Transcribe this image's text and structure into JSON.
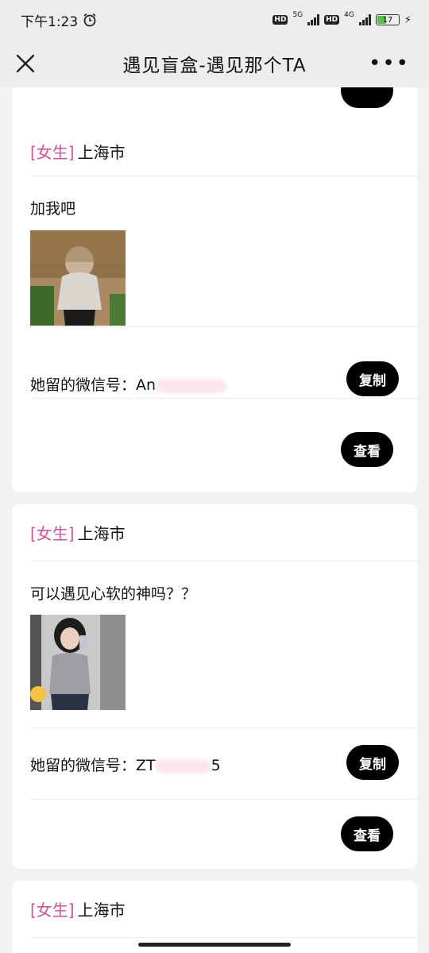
{
  "status": {
    "time": "下午1:23",
    "net1": "5G",
    "net2": "4G",
    "hd": "HD",
    "battery": "17"
  },
  "nav": {
    "title": "遇见盲盒-遇见那个TA",
    "more": "•••"
  },
  "cards": [
    {
      "gender": "[女生]",
      "city": "上海市",
      "message": "加我吧",
      "wechat_label": "她留的微信号：",
      "wechat_visible": "An",
      "copy": "复制",
      "view": "查看"
    },
    {
      "gender": "[女生]",
      "city": "上海市",
      "message": "可以遇见心软的神吗？？",
      "wechat_label": "她留的微信号：",
      "wechat_visible": "ZT",
      "wechat_tail": "5",
      "copy": "复制",
      "view": "查看"
    },
    {
      "gender": "[女生]",
      "city": "上海市"
    }
  ]
}
